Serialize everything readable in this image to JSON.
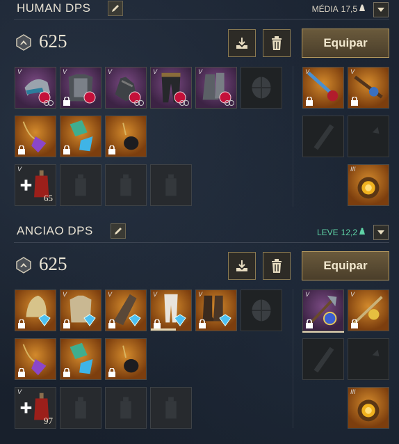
{
  "loadouts": [
    {
      "name": "HUMAN DPS",
      "weight_label": "MÉDIA",
      "weight_value": "17,5",
      "weight_color": "#e3ddd0",
      "gear_score": "625",
      "equip_label": "Equipar",
      "heal_qty": "65"
    },
    {
      "name": "ANCIAO DPS",
      "weight_label": "LEVE",
      "weight_value": "12,2",
      "weight_color": "#5fd3a6",
      "gear_score": "625",
      "equip_label": "Equipar",
      "heal_qty": "97"
    }
  ],
  "colors": {
    "accent_gold": "#b79a5e",
    "rarity_epic": "#7a4a82",
    "rarity_legendary": "#d38a2c",
    "weight_light": "#5fd3a6"
  },
  "icons": [
    "edit-icon",
    "weight-icon",
    "chevron-down-icon",
    "gear-score-icon",
    "download-icon",
    "trash-icon",
    "lock-icon",
    "gem-icon",
    "plus-icon"
  ]
}
